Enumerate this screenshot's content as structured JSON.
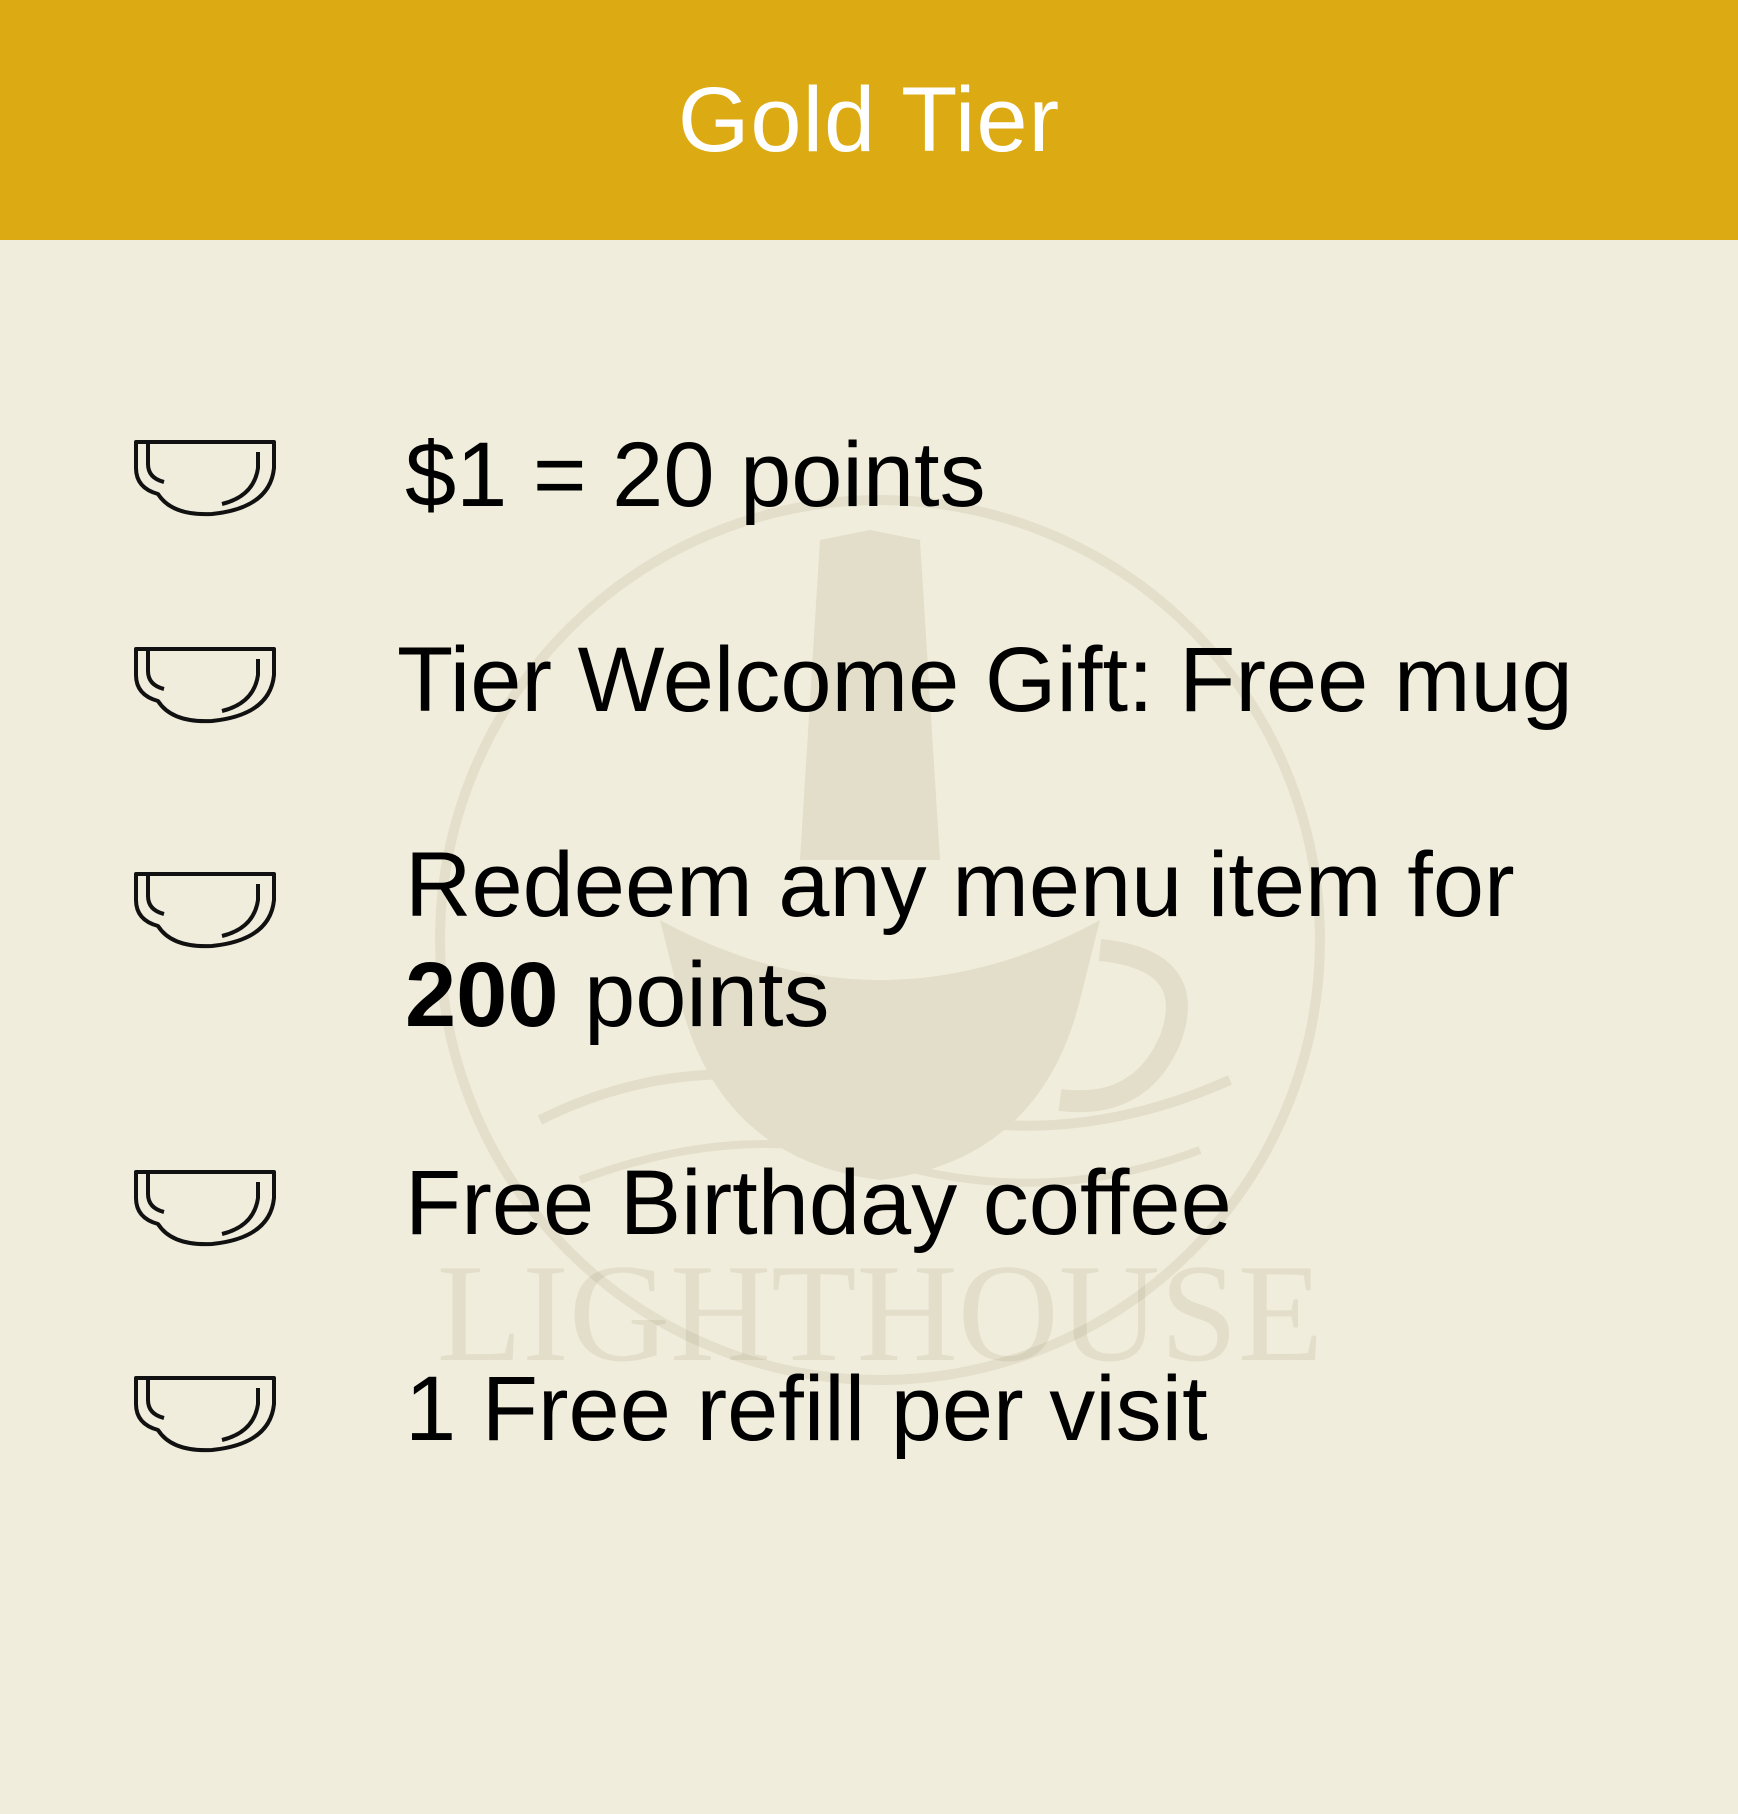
{
  "header": {
    "title": "Gold Tier",
    "background_color": "#dcab14",
    "text_color": "#ffffff"
  },
  "page_background_color": "#f0eddc",
  "watermark": {
    "text": "LIGHTHOUSE",
    "icon": "lighthouse-coffee-logo"
  },
  "benefits": [
    {
      "icon": "coffee-cup-icon",
      "text": "$1 = 20 points"
    },
    {
      "icon": "coffee-cup-icon",
      "text": "Tier Welcome Gift: Free mug"
    },
    {
      "icon": "coffee-cup-icon",
      "text_before": "Redeem any menu item for",
      "text_bold": "200",
      "text_after": "points"
    },
    {
      "icon": "coffee-cup-icon",
      "text": "Free Birthday coffee"
    },
    {
      "icon": "coffee-cup-icon",
      "text": "1 Free refill per visit"
    }
  ]
}
